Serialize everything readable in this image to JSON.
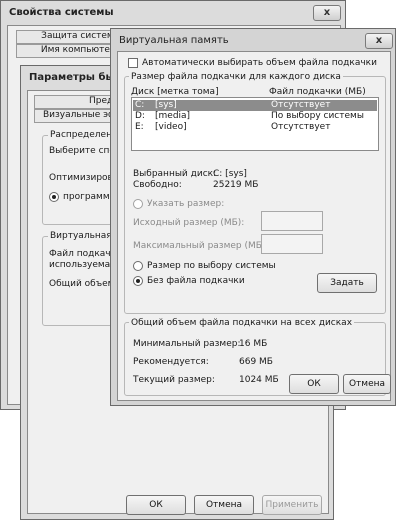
{
  "system_props": {
    "title": "Свойства системы",
    "tabs": [
      "Защита системы",
      "Имя компьютера"
    ]
  },
  "perf_options": {
    "title": "Параметры быстродействия",
    "tabs": [
      "Предотвращение выполнения данных",
      "Визуальные эффекты"
    ],
    "group_cpu": {
      "title": "Распределение времени процессора",
      "text": "Выберите способ распределения ресурсов процессора.",
      "optimize": "Оптимизировать работу:",
      "radio_programs": "программ"
    },
    "group_vm": {
      "title": "Виртуальная память",
      "text1": "Файл подкачки - область на жестком диске,",
      "text2": "используемая Windows как ОЗУ.",
      "total": "Общий объем файла подкачки на всех дисках:"
    },
    "buttons": {
      "ok": "ОК",
      "cancel": "Отмена",
      "apply": "Применить"
    }
  },
  "vm_dialog": {
    "title": "Виртуальная память",
    "close_glyph": "x",
    "auto_checkbox": "Автоматически выбирать объем файла подкачки",
    "section_disks": "Размер файла подкачки для каждого диска",
    "col_disk": "Диск [метка тома]",
    "col_size": "Файл подкачки (МБ)",
    "drives": [
      {
        "letter": "C:",
        "label": "[sys]",
        "status": "Отсутствует"
      },
      {
        "letter": "D:",
        "label": "[media]",
        "status": "По выбору системы"
      },
      {
        "letter": "E:",
        "label": "[video]",
        "status": "Отсутствует"
      }
    ],
    "selected_disk_label": "Выбранный диск:",
    "selected_disk_value": "C: [sys]",
    "free_label": "Свободно:",
    "free_value": "25219 МБ",
    "radio_custom": "Указать размер:",
    "initial_size": "Исходный размер (МБ):",
    "max_size": "Максимальный размер (МБ):",
    "radio_system": "Размер по выбору системы",
    "radio_none": "Без файла подкачки",
    "set_button": "Задать",
    "section_total": "Общий объем файла подкачки на всех дисках",
    "min_label": "Минимальный размер:",
    "min_value": "16 МБ",
    "rec_label": "Рекомендуется:",
    "rec_value": "669 МБ",
    "cur_label": "Текущий размер:",
    "cur_value": "1024 МБ",
    "ok": "ОК",
    "cancel": "Отмена"
  }
}
